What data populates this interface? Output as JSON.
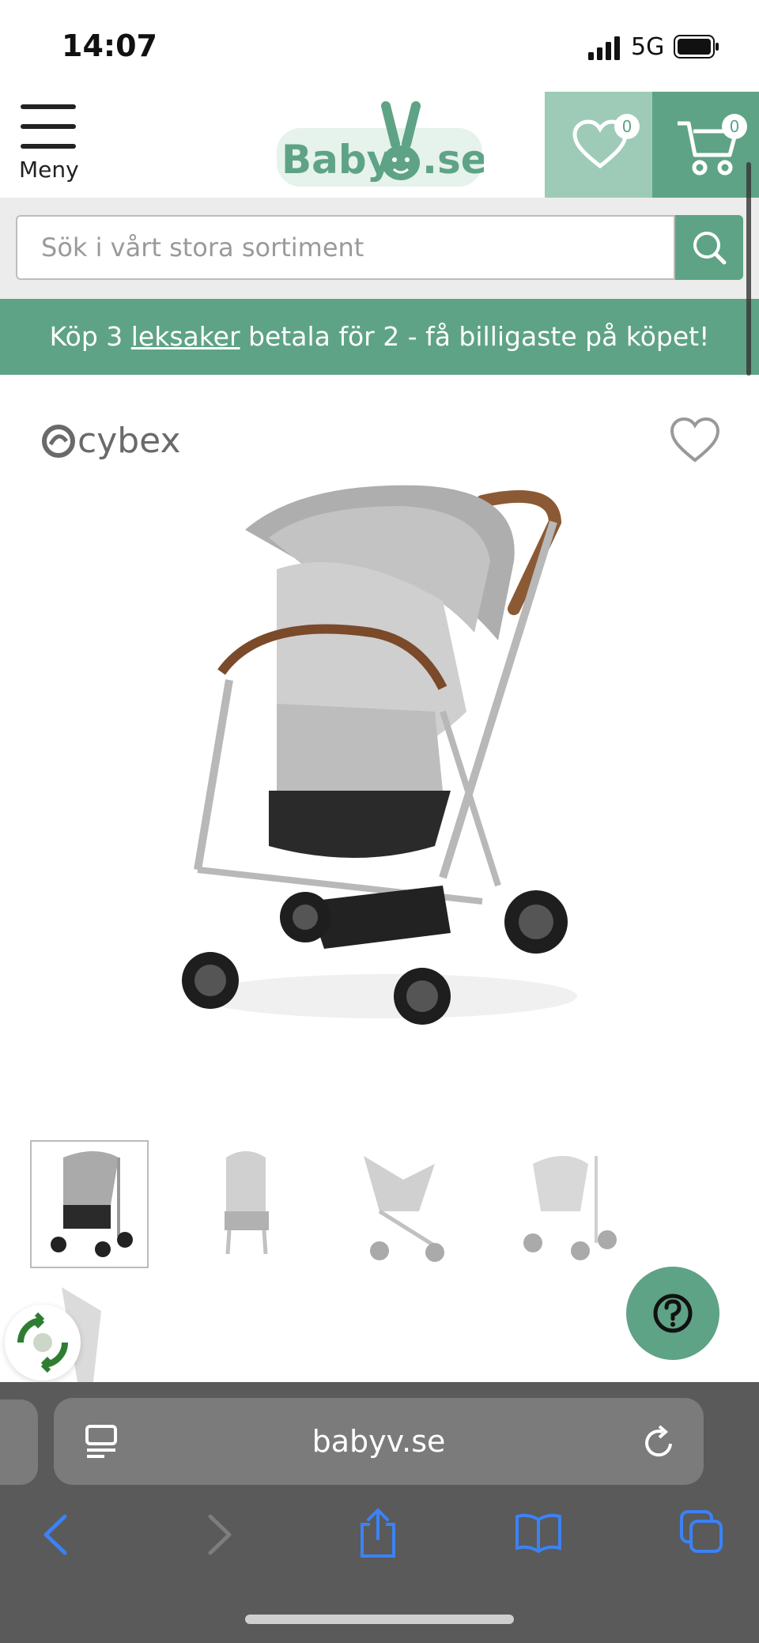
{
  "status_bar": {
    "time": "14:07",
    "network": "5G"
  },
  "header": {
    "menu_label": "Meny",
    "logo_text_left": "Baby",
    "logo_text_right": ".se",
    "wishlist_count": "0",
    "cart_count": "0"
  },
  "search": {
    "placeholder": "Sök i vårt stora sortiment"
  },
  "promo": {
    "prefix": "Köp 3 ",
    "link": "leksaker",
    "suffix": " betala för 2 - få billigaste på köpet!"
  },
  "product": {
    "brand": "cybex"
  },
  "browser": {
    "url": "babyv.se"
  },
  "colors": {
    "brand_green": "#5ea386",
    "brand_light_green": "#9dcbb8",
    "browser_blue": "#3b82f6"
  }
}
